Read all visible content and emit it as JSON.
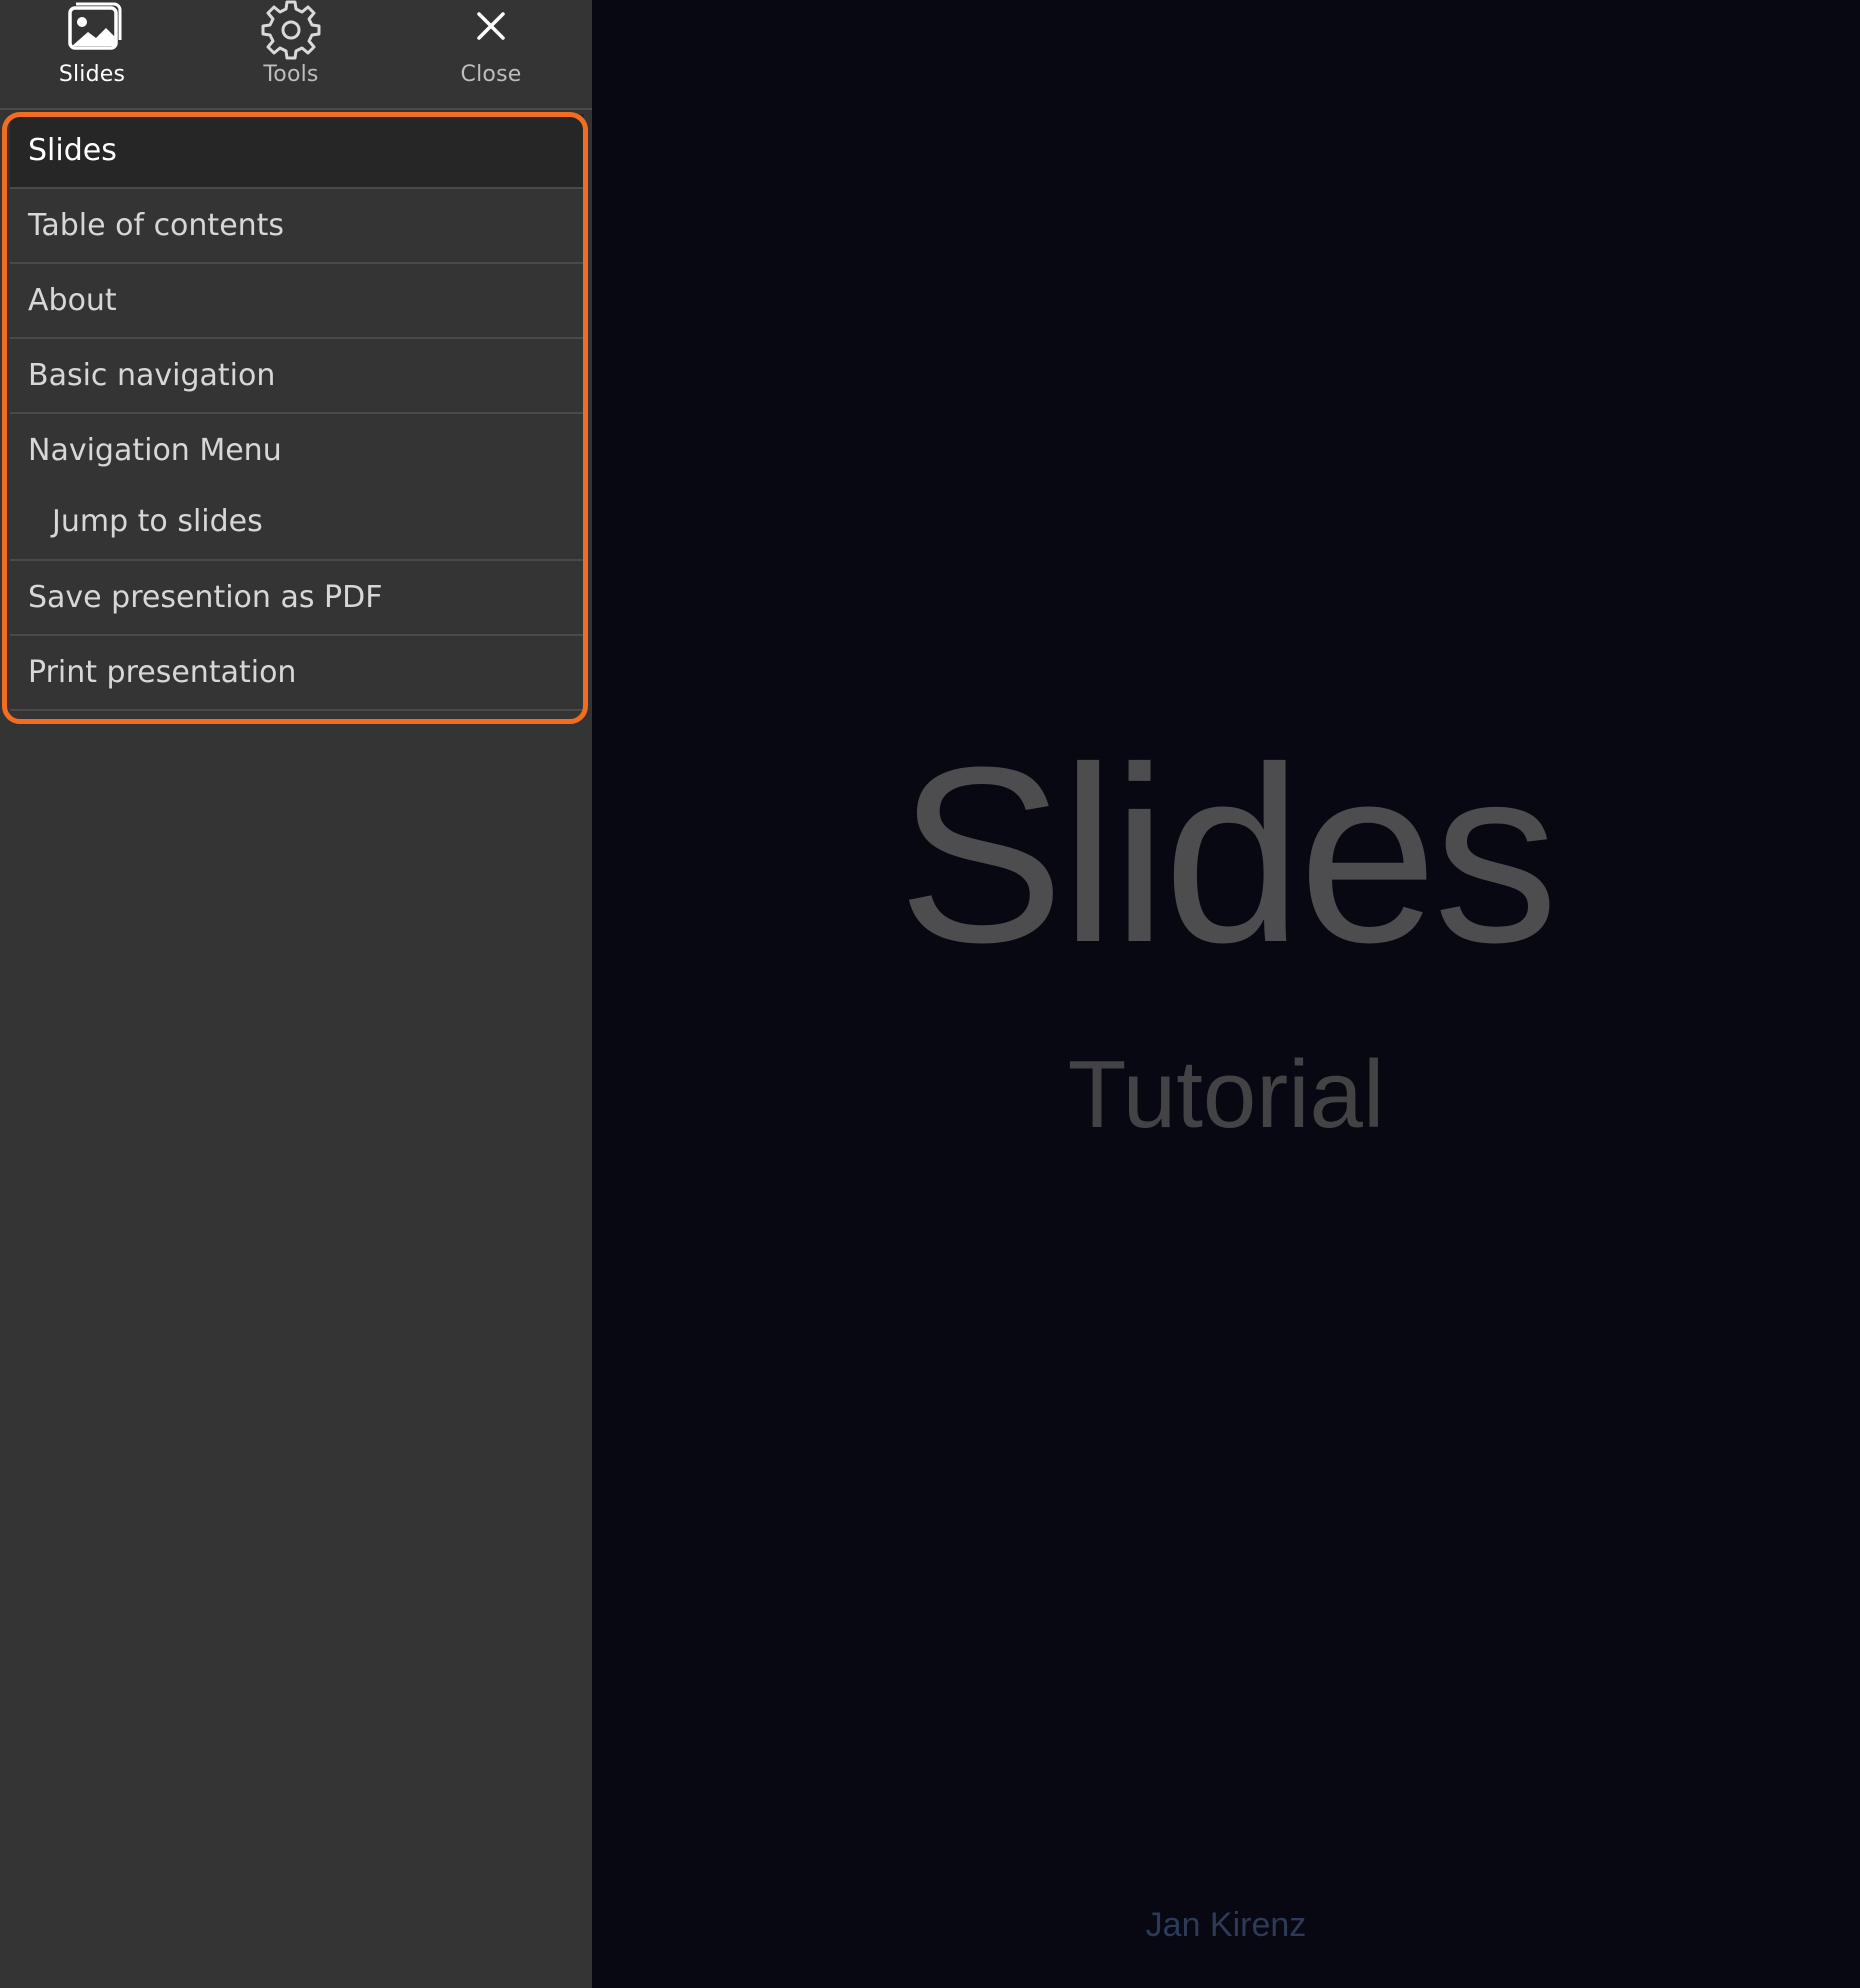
{
  "toolbar": {
    "slides_label": "Slides",
    "tools_label": "Tools",
    "close_label": "Close"
  },
  "menu": {
    "items": [
      {
        "label": "Slides"
      },
      {
        "label": "Table of contents"
      },
      {
        "label": "About"
      },
      {
        "label": "Basic navigation"
      },
      {
        "label": "Navigation Menu",
        "sub": "Jump to slides"
      },
      {
        "label": "Save presention as PDF"
      },
      {
        "label": "Print presentation"
      }
    ]
  },
  "slide": {
    "title": "Slides",
    "subtitle": "Tutorial",
    "author": "Jan Kirenz"
  },
  "colors": {
    "accent_highlight": "#f26d21",
    "sidebar_bg": "#343434",
    "slide_bg": "#070812"
  },
  "icons": {
    "slides": "image-icon",
    "tools": "gear-icon",
    "close": "close-icon"
  }
}
